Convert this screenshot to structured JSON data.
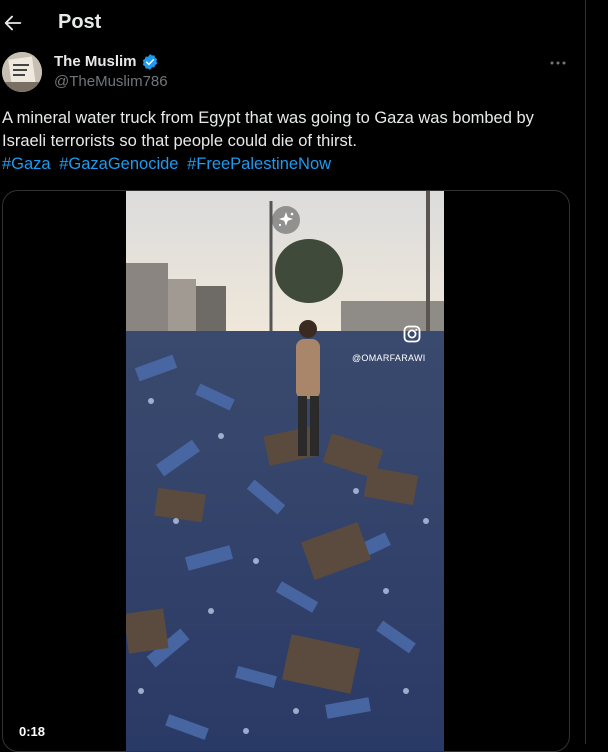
{
  "header": {
    "title": "Post",
    "back_icon": "arrow-left-icon"
  },
  "author": {
    "name": "The Muslim",
    "handle": "@TheMuslim786",
    "verified_icon": "verified-badge-icon",
    "more_icon": "more-horizontal-icon"
  },
  "tweet": {
    "text": "A mineral water truck from Egypt that was going to Gaza was bombed by Israeli terrorists so that people could die of thirst.",
    "hashtags": [
      "#Gaza",
      "#GazaGenocide",
      "#FreePalestineNow"
    ]
  },
  "media": {
    "duration": "0:18",
    "watermark": "@OMARFARAWI"
  },
  "colors": {
    "background": "#000000",
    "text": "#e7e9ea",
    "muted": "#71767b",
    "link": "#1d9bf0",
    "verified": "#1d9bf0"
  }
}
